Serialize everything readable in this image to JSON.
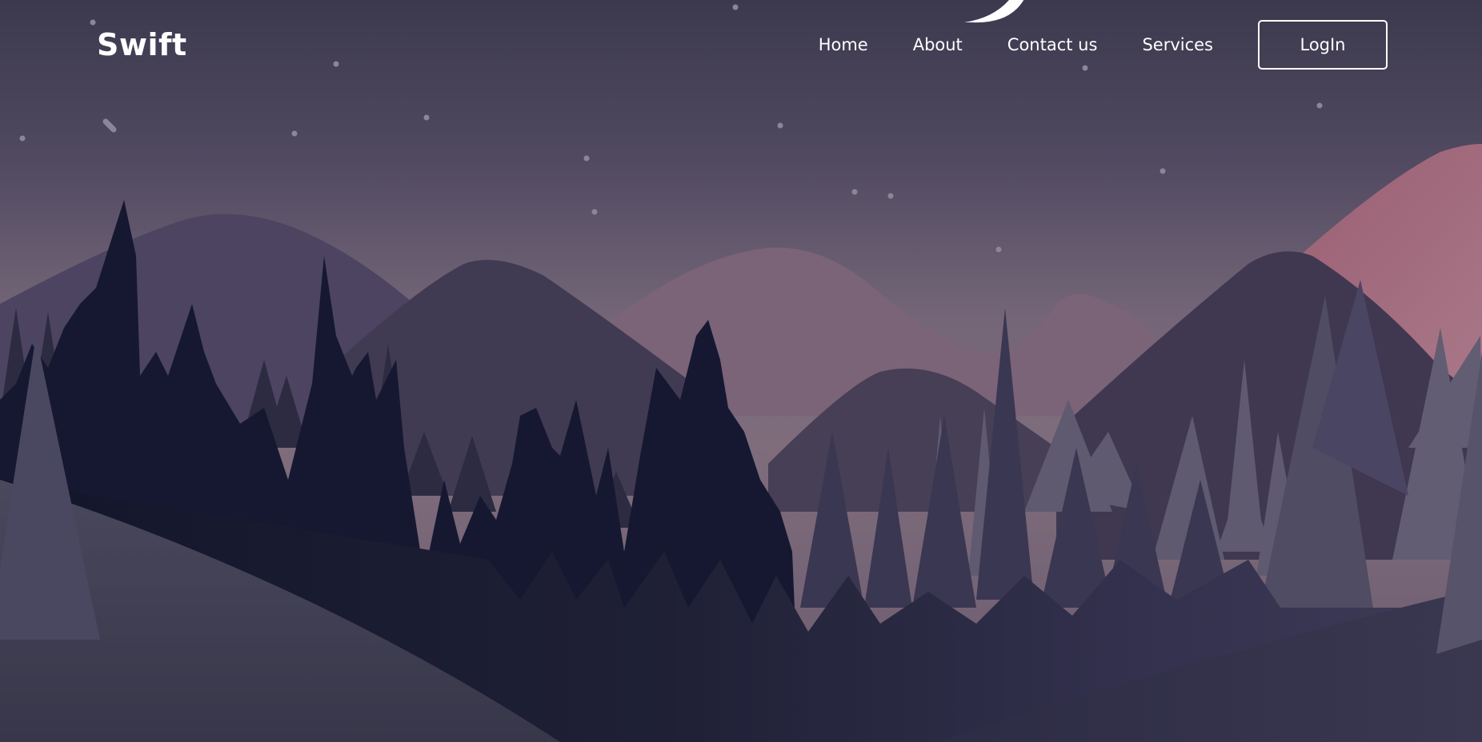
{
  "brand": {
    "name": "Swift"
  },
  "nav": {
    "links": [
      {
        "label": "Home"
      },
      {
        "label": "About"
      },
      {
        "label": "Contact us"
      },
      {
        "label": "Services"
      }
    ],
    "login_label": "LogIn"
  },
  "theme": {
    "sky_top": "#3e3b50",
    "sky_horizon": "#7a6a7a",
    "sunset_glow": "#9a6070",
    "mountain_far": "#4a4260",
    "mountain_mid": "#3b3650",
    "mountain_pink": "#7b6378",
    "tree_dark": "#121528",
    "tree_mid": "#2e2f4a",
    "tree_light": "#5f5b72",
    "text_color": "#ffffff"
  },
  "icons": {
    "moon": "crescent-moon",
    "stars": "star-dots"
  }
}
